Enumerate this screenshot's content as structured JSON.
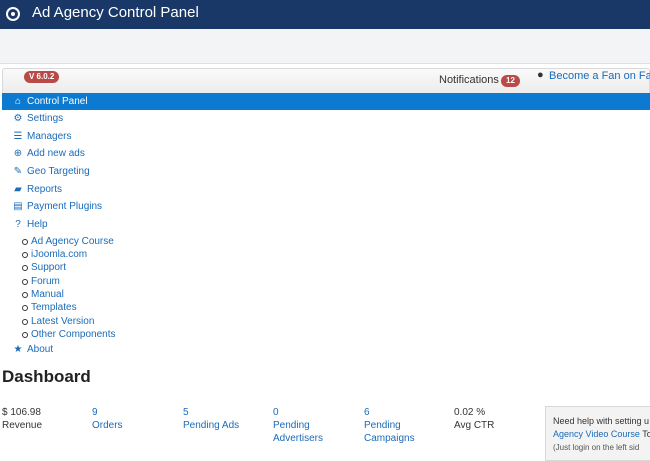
{
  "header": {
    "title": "Ad Agency Control Panel"
  },
  "topbar": {
    "version": "V 6.0.2",
    "notifications_label": "Notifications",
    "notifications_count": "12",
    "fan_link": "Become a Fan on Fac"
  },
  "nav": {
    "control_panel": "Control Panel",
    "settings": "Settings",
    "managers": "Managers",
    "add_new_ads": "Add new ads",
    "geo_targeting": "Geo Targeting",
    "reports": "Reports",
    "payment_plugins": "Payment Plugins",
    "help": "Help",
    "help_items": [
      "Ad Agency Course",
      "iJoomla.com",
      "Support",
      "Forum",
      "Manual",
      "Templates",
      "Latest Version",
      "Other Components"
    ],
    "about": "About"
  },
  "dashboard": {
    "title": "Dashboard",
    "revenue_value": "$ 106.98",
    "revenue_label": "Revenue",
    "orders_value": "9",
    "orders_label": "Orders",
    "pending_ads_value": "5",
    "pending_ads_label": "Pending Ads",
    "pending_advertisers_value": "0",
    "pending_advertisers_label_1": "Pending",
    "pending_advertisers_label_2": "Advertisers",
    "pending_campaigns_value": "6",
    "pending_campaigns_label_1": "Pending",
    "pending_campaigns_label_2": "Campaigns",
    "ctr_value": "0.02 %",
    "ctr_label": "Avg CTR"
  },
  "help_box": {
    "line1": "Need help with setting u",
    "link": "Agency Video Course",
    "link_suffix": " To",
    "line3": "(Just login on the left sid"
  },
  "colors": {
    "header_bg": "#1a3867",
    "active_nav": "#0b7ad0",
    "link": "#1a6bb8",
    "badge": "#b94a48"
  }
}
